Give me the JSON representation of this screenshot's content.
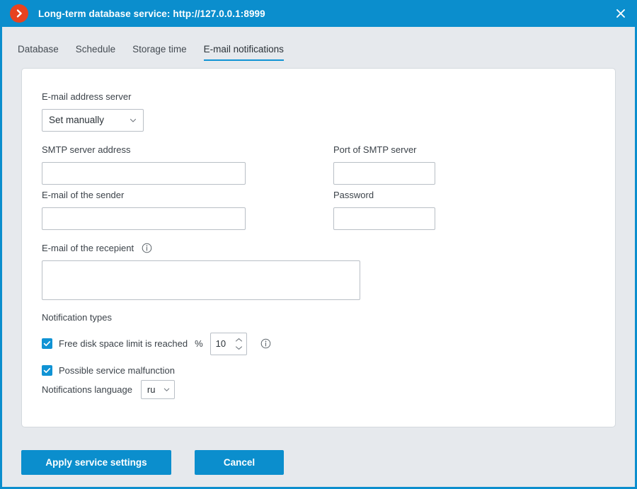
{
  "titlebar": {
    "logo_icon": "chevron-right-circle-icon",
    "title": "Long-term database service: http://127.0.0.1:8999",
    "close_icon": "close-icon",
    "bg_color": "#0b8ecd",
    "logo_color": "#e8431f"
  },
  "tabs": [
    {
      "label": "Database",
      "active": false
    },
    {
      "label": "Schedule",
      "active": false
    },
    {
      "label": "Storage time",
      "active": false
    },
    {
      "label": "E-mail notifications",
      "active": true
    }
  ],
  "form": {
    "email_address_server": {
      "label": "E-mail address server",
      "value": "Set manually",
      "options": [
        "Set manually"
      ]
    },
    "smtp_server_address": {
      "label": "SMTP server address",
      "value": "",
      "placeholder": ""
    },
    "port_of_smtp_server": {
      "label": "Port of SMTP server",
      "value": "",
      "placeholder": ""
    },
    "email_of_sender": {
      "label": "E-mail of the sender",
      "value": "",
      "placeholder": ""
    },
    "password": {
      "label": "Password",
      "value": "",
      "placeholder": ""
    },
    "email_of_recipient": {
      "label": "E-mail of the recepient",
      "info_icon": "info-icon",
      "value": "",
      "placeholder": ""
    },
    "notification_types": {
      "label": "Notification types",
      "items": [
        {
          "label": "Free disk space limit is reached",
          "checked": true,
          "percent_sign": "%",
          "percent_value": "10",
          "info_icon": "info-icon"
        },
        {
          "label": "Possible service malfunction",
          "checked": true
        }
      ]
    },
    "notifications_language": {
      "label": "Notifications language",
      "value": "ru",
      "options": [
        "ru"
      ]
    }
  },
  "footer": {
    "apply_label": "Apply service settings",
    "cancel_label": "Cancel"
  },
  "colors": {
    "accent": "#0b8ecd",
    "tab_underline": "#1093d4",
    "checkbox": "#1093d4",
    "window_bg": "#e6e9ed",
    "card_bg": "#ffffff",
    "border": "#b9bfc6"
  }
}
